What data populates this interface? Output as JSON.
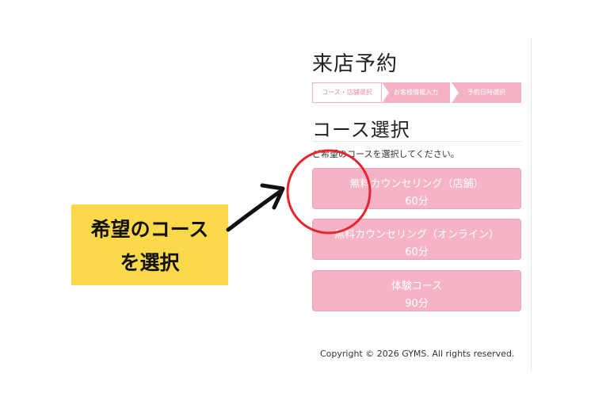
{
  "page": {
    "title": "来店予約",
    "steps": [
      "コース・店舗選択",
      "お客様情報入力",
      "予約日時選択"
    ],
    "section_title": "コース選択",
    "instruction": "ご希望のコースを選択してください。",
    "courses": [
      {
        "name": "無料カウンセリング（店舗）",
        "duration": "60分"
      },
      {
        "name": "無料カウンセリング（オンライン）",
        "duration": "60分"
      },
      {
        "name": "体験コース",
        "duration": "90分"
      }
    ],
    "copyright": "Copyright © 2026 GYMS. All rights reserved."
  },
  "annotation": {
    "callout_line1": "希望のコース",
    "callout_line2": "を選択"
  },
  "colors": {
    "accent_pink": "#f5b3c6",
    "callout_yellow": "#fcd84a",
    "highlight_red": "#e8242c"
  }
}
